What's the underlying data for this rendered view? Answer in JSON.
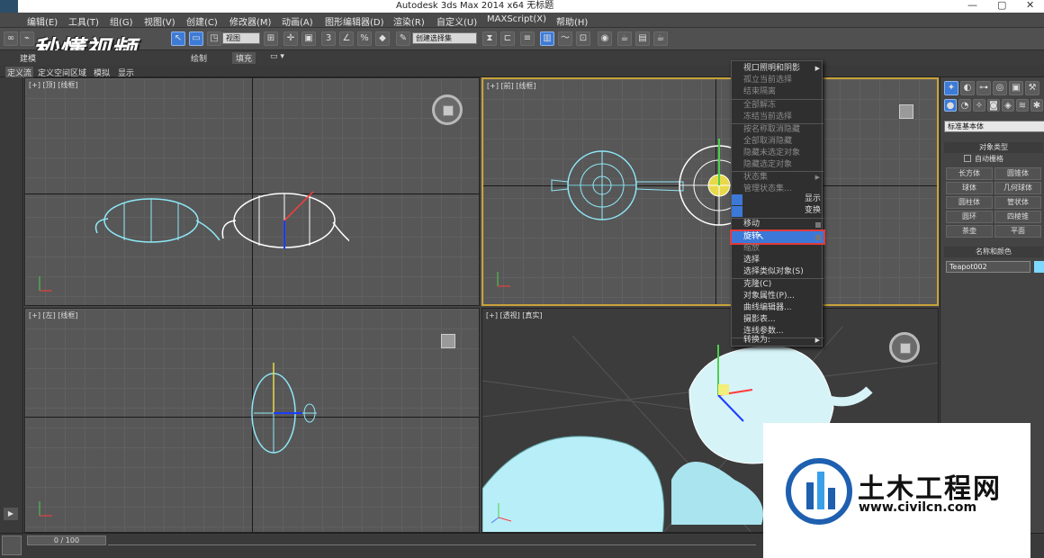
{
  "window": {
    "title": "Autodesk 3ds Max  2014 x64     无标题",
    "minimize": "—",
    "maximize": "▢",
    "close": "✕"
  },
  "menubar": [
    "编辑(E)",
    "工具(T)",
    "组(G)",
    "视图(V)",
    "创建(C)",
    "修改器(M)",
    "动画(A)",
    "图形编辑器(D)",
    "渲染(R)",
    "自定义(U)",
    "MAXScript(X)",
    "帮助(H)"
  ],
  "toolbar": {
    "view_dropdown": "视图",
    "selection_set": "创建选择集"
  },
  "ribbon": {
    "tab_model": "建模",
    "tab_paint": "绘制",
    "fill": "填充"
  },
  "tabs2": [
    "定义流",
    "定义空间区域",
    "模拟",
    "显示"
  ],
  "watermark": "秒懂视频",
  "viewports": {
    "top_left": "[+] [顶] [线框]",
    "top_right": "[+] [前] [线框]",
    "bottom_left": "[+] [左] [线框]",
    "bottom_right": "[+] [透视] [真实]"
  },
  "context_menu": {
    "items": [
      {
        "label": "视口照明和阴影",
        "disabled": false,
        "submenu": true
      },
      {
        "label": "孤立当前选择",
        "disabled": true,
        "submenu": false
      },
      {
        "label": "结束隔离",
        "disabled": true,
        "submenu": false
      },
      {
        "label": "全部解冻",
        "disabled": true,
        "submenu": false
      },
      {
        "label": "冻结当前选择",
        "disabled": true,
        "submenu": false
      },
      {
        "label": "按名称取消隐藏",
        "disabled": true,
        "submenu": false
      },
      {
        "label": "全部取消隐藏",
        "disabled": true,
        "submenu": false
      },
      {
        "label": "隐藏未选定对象",
        "disabled": true,
        "submenu": false
      },
      {
        "label": "隐藏选定对象",
        "disabled": true,
        "submenu": false
      },
      {
        "label": "状态集",
        "disabled": true,
        "submenu": true
      },
      {
        "label": "管理状态集...",
        "disabled": true,
        "submenu": false
      }
    ],
    "section_labels": [
      "显示",
      "变换"
    ],
    "transform_items": [
      {
        "label": "移动",
        "highlight": false
      },
      {
        "label": "旋转",
        "highlight": true
      },
      {
        "label": "缩放",
        "highlight": false
      },
      {
        "label": "选择",
        "highlight": false
      },
      {
        "label": "选择类似对象(S)",
        "highlight": false
      },
      {
        "label": "克隆(C)",
        "highlight": false
      },
      {
        "label": "对象属性(P)...",
        "highlight": false
      },
      {
        "label": "曲线编辑器...",
        "highlight": false
      },
      {
        "label": "摄影表...",
        "highlight": false
      },
      {
        "label": "连线参数...",
        "highlight": false
      },
      {
        "label": "转换为:",
        "highlight": false
      }
    ]
  },
  "command_panel": {
    "category_dropdown": "标准基本体",
    "object_type_title": "对象类型",
    "autogrid": "自动栅格",
    "buttons": [
      "长方体",
      "圆锥体",
      "球体",
      "几何球体",
      "圆柱体",
      "管状体",
      "圆环",
      "四棱锥",
      "茶壶",
      "平面"
    ],
    "name_color_title": "名称和颜色",
    "object_name": "Teapot002",
    "color": "#7fd8ff"
  },
  "timeline": {
    "frame": "0 / 100"
  },
  "site_logo": {
    "name": "土木工程网",
    "url": "www.civilcn.com"
  },
  "colors": {
    "accent_blue": "#3c78d8",
    "highlight_red": "#e23a3a",
    "active_viewport": "#c9a33a",
    "teapot_cyan": "#8fe8f8"
  }
}
